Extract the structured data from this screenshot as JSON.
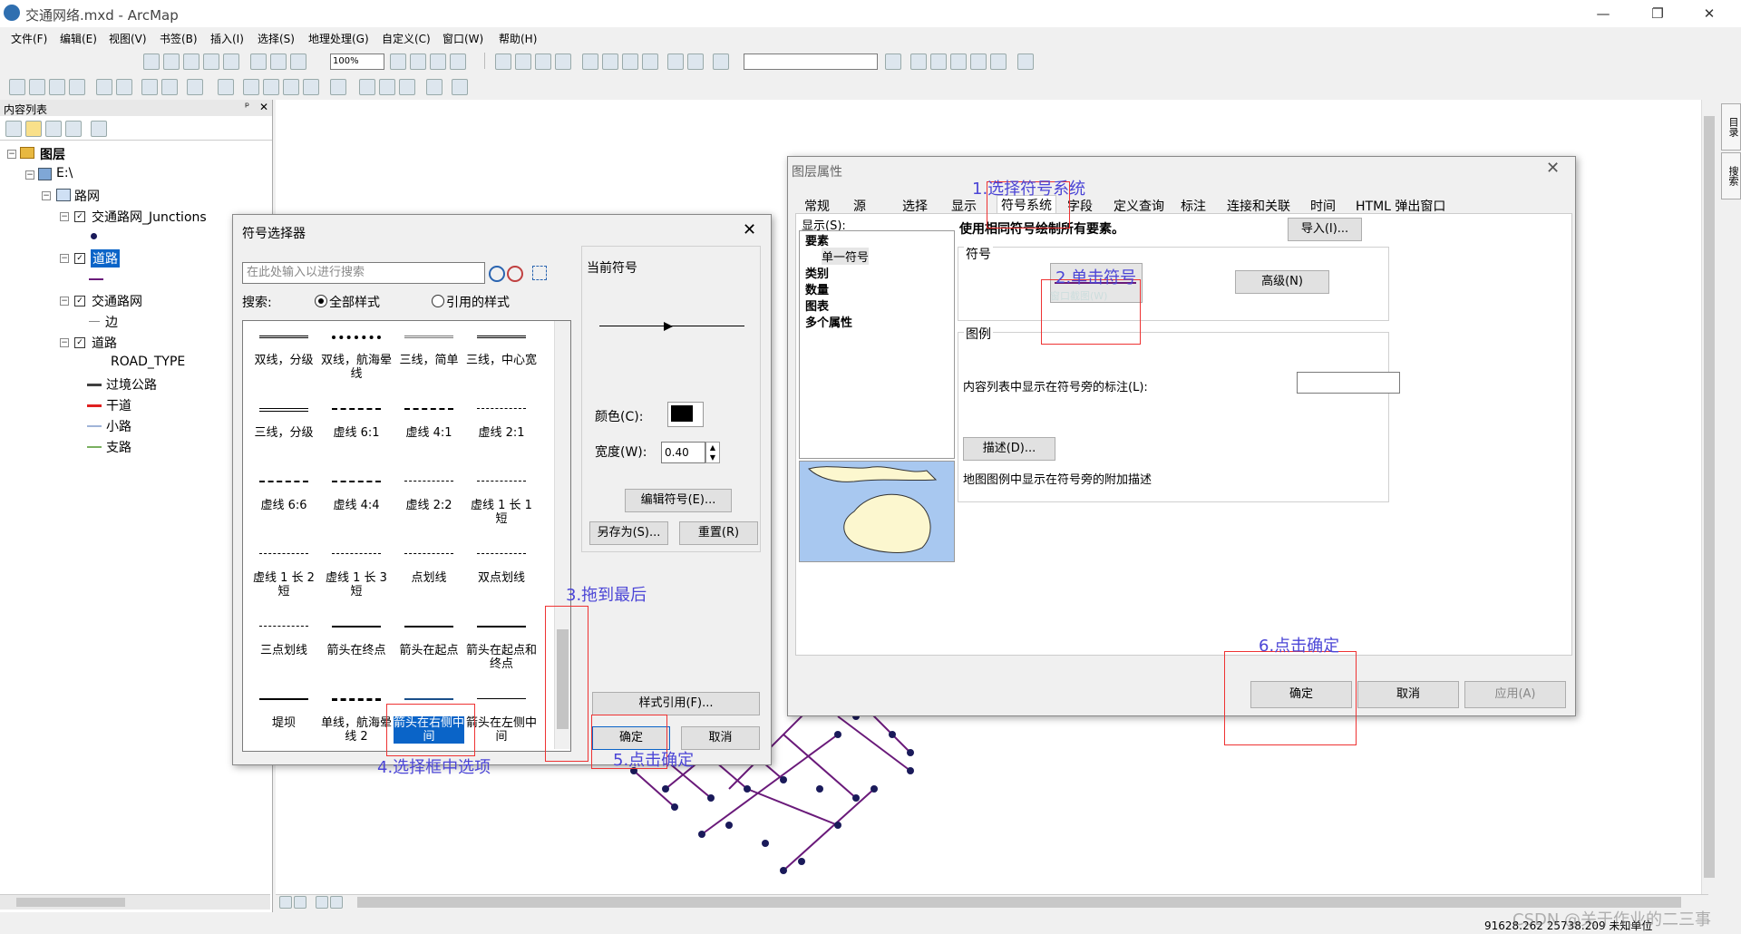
{
  "window": {
    "title": "交通网络.mxd - ArcMap",
    "min": "—",
    "max": "❐",
    "close": "✕"
  },
  "menus": [
    "文件(F)",
    "编辑(E)",
    "视图(V)",
    "书签(B)",
    "插入(I)",
    "选择(S)",
    "地理处理(G)",
    "自定义(C)",
    "窗口(W)",
    "帮助(H)"
  ],
  "toolbar": {
    "zoom": "100%"
  },
  "toc": {
    "title": "内容列表",
    "pin": "ᵖ",
    "close": "✕",
    "items": [
      {
        "label": "图层"
      },
      {
        "label": "E:\\"
      },
      {
        "label": "路网"
      },
      {
        "label": "交通路网_Junctions"
      },
      {
        "label": "道路"
      },
      {
        "label": "交通路网"
      },
      {
        "label": "边"
      },
      {
        "label": "道路"
      },
      {
        "label": "ROAD_TYPE"
      },
      {
        "label": "过境公路",
        "color": "#404040"
      },
      {
        "label": "干道",
        "color": "#e02020"
      },
      {
        "label": "小路",
        "color": "#a0b4d8"
      },
      {
        "label": "支路",
        "color": "#7ab060"
      }
    ]
  },
  "side_tabs": [
    "目录",
    "搜索"
  ],
  "status": {
    "coords": "91628.262  25738.209 未知单位",
    "watermark": "CSDN @关于作业的二三事"
  },
  "symbol_selector": {
    "title": "符号选择器",
    "search_placeholder": "在此处输入以进行搜索",
    "search_label": "搜索:",
    "radio_all": "全部样式",
    "radio_ref": "引用的样式",
    "current_symbol": "当前符号",
    "color_label": "颜色(C):",
    "width_label": "宽度(W):",
    "width_value": "0.40",
    "edit_btn": "编辑符号(E)...",
    "saveas_btn": "另存为(S)...",
    "reset_btn": "重置(R)",
    "style_btn": "样式引用(F)...",
    "ok_btn": "确定",
    "cancel_btn": "取消",
    "symbols": [
      "双线，分级",
      "双线，航海晕线",
      "三线，简单",
      "三线，中心宽",
      "三线，分级",
      "虚线 6:1",
      "虚线 4:1",
      "虚线 2:1",
      "虚线 6:6",
      "虚线 4:4",
      "虚线 2:2",
      "虚线 1 长 1 短",
      "虚线 1 长 2 短",
      "虚线 1 长 3 短",
      "点划线",
      "双点划线",
      "三点划线",
      "箭头在终点",
      "箭头在起点",
      "箭头在起点和终点",
      "堤坝",
      "单线，航海晕线 2",
      "箭头在右侧中间",
      "箭头在左侧中间"
    ]
  },
  "layer_props": {
    "title": "图层属性",
    "tabs": [
      "常规",
      "源",
      "选择",
      "显示",
      "符号系统",
      "字段",
      "定义查询",
      "标注",
      "连接和关联",
      "时间",
      "HTML 弹出窗口"
    ],
    "show_label": "显示(S):",
    "show_items": [
      "要素",
      "单一符号",
      "类别",
      "数量",
      "图表",
      "多个属性"
    ],
    "heading": "使用相同符号绘制所有要素。",
    "import_btn": "导入(I)...",
    "symbol_group": "符号",
    "symbol_hint": "窗口截图(W)",
    "advanced_btn": "高级(N)",
    "legend_group": "图例",
    "legend_label": "内容列表中显示在符号旁的标注(L):",
    "describe_btn": "描述(D)...",
    "describe_note": "地图图例中显示在符号旁的附加描述",
    "ok_btn": "确定",
    "cancel_btn": "取消",
    "apply_btn": "应用(A)"
  },
  "annotations": {
    "a1": "1.选择符号系统",
    "a2": "2.单击符号",
    "a3": "3.拖到最后",
    "a4": "4.选择框中选项",
    "a5": "5.点击确定",
    "a6": "6.点击确定"
  },
  "colors": {
    "selection": "#0a64c8",
    "road": "#6a1a7a",
    "node": "#1a1a5a",
    "annotation": "#4b45d6",
    "highlight": "#e33333"
  }
}
